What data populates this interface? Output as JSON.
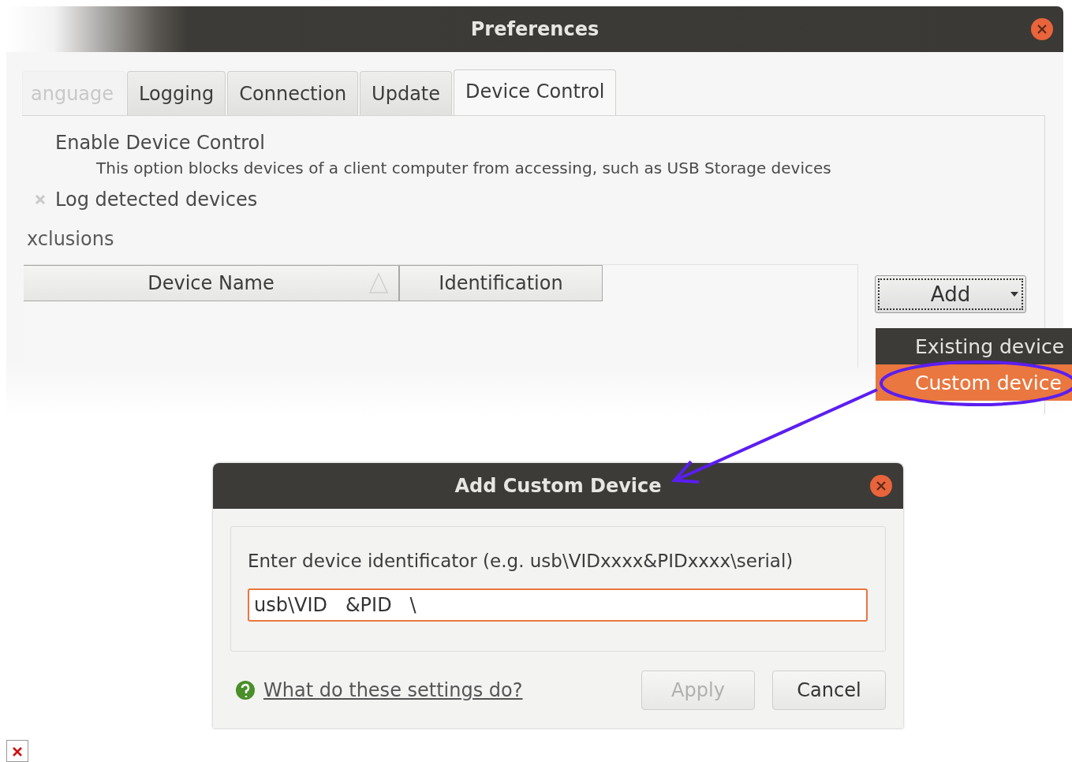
{
  "window": {
    "title": "Preferences"
  },
  "tabs": [
    {
      "label": "anguage",
      "selected": false
    },
    {
      "label": "Logging",
      "selected": false
    },
    {
      "label": "Connection",
      "selected": false
    },
    {
      "label": "Update",
      "selected": false
    },
    {
      "label": "Device Control",
      "selected": true
    }
  ],
  "options": [
    {
      "label": "Enable Device Control",
      "checked": false,
      "description": "This option blocks devices of a client computer from accessing, such as USB Storage devices"
    },
    {
      "label": "Log detected devices",
      "checked": true
    }
  ],
  "exclusions": {
    "heading": "xclusions"
  },
  "table": {
    "columns": [
      {
        "label": "Device Name",
        "sorted": true
      },
      {
        "label": "Identification",
        "sorted": false
      }
    ]
  },
  "add_button": {
    "label": "Add"
  },
  "add_menu": [
    {
      "label": "Existing device",
      "selected": false
    },
    {
      "label": "Custom device",
      "selected": true
    }
  ],
  "dialog": {
    "title": "Add Custom Device",
    "prompt": "Enter device identificator (e.g. usb\\VIDxxxx&PIDxxxx\\serial)",
    "input": {
      "value": "usb\\VID   &PID   \\"
    },
    "help_link": "What do these settings do?",
    "buttons": [
      {
        "label": "Apply",
        "disabled": true
      },
      {
        "label": "Cancel",
        "disabled": false
      }
    ]
  }
}
